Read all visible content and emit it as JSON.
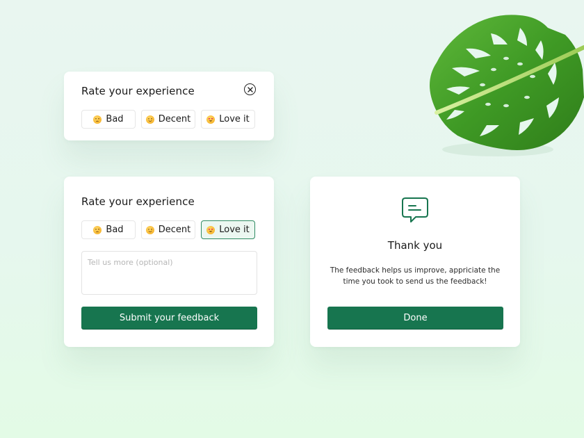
{
  "compact_card": {
    "title": "Rate your experience",
    "options": [
      {
        "label": "Bad",
        "icon": "pensive-face-emoji"
      },
      {
        "label": "Decent",
        "icon": "smiling-face-emoji"
      },
      {
        "label": "Love it",
        "icon": "heart-eyes-emoji"
      }
    ]
  },
  "expanded_card": {
    "title": "Rate your experience",
    "options": [
      {
        "label": "Bad",
        "icon": "pensive-face-emoji"
      },
      {
        "label": "Decent",
        "icon": "smiling-face-emoji"
      },
      {
        "label": "Love it",
        "icon": "heart-eyes-emoji",
        "selected": true
      }
    ],
    "comment_placeholder": "Tell us more (optional)",
    "comment_value": "",
    "submit_label": "Submit your feedback"
  },
  "thanks_card": {
    "icon": "message-icon",
    "title": "Thank you",
    "message": "The feedback helps us improve, appriciate the time you took to send us the feedback!",
    "done_label": "Done"
  },
  "colors": {
    "accent": "#17754f",
    "selected_bg": "#ecf7f1",
    "selected_border": "#2f8b63",
    "background": "#e6f7ee"
  }
}
